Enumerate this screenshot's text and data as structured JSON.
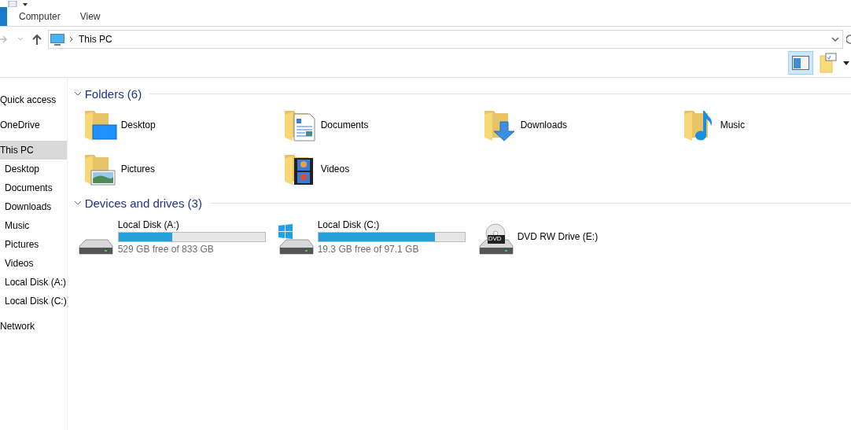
{
  "ribbon": {
    "tabs": [
      {
        "label": "Computer",
        "selected": false
      },
      {
        "label": "View",
        "selected": false
      }
    ]
  },
  "address": {
    "path": "This PC"
  },
  "toolbar": {
    "preview_pane": {
      "selected": true
    }
  },
  "sidebar": {
    "items": [
      {
        "label": "Quick access",
        "selected": false
      },
      {
        "label": "OneDrive",
        "selected": false
      },
      {
        "label": "This PC",
        "selected": true,
        "children": [
          {
            "label": "Desktop",
            "selected": false
          },
          {
            "label": "Documents",
            "selected": false
          },
          {
            "label": "Downloads",
            "selected": false
          },
          {
            "label": "Music",
            "selected": false
          },
          {
            "label": "Pictures",
            "selected": false
          },
          {
            "label": "Videos",
            "selected": false
          },
          {
            "label": "Local Disk (A:)",
            "selected": false
          },
          {
            "label": "Local Disk (C:)",
            "selected": false
          }
        ]
      },
      {
        "label": "Network",
        "selected": false
      }
    ]
  },
  "sections": [
    {
      "title": "Folders (6)",
      "expanded": true,
      "items": [
        {
          "kind": "desktop",
          "name": "Desktop"
        },
        {
          "kind": "documents",
          "name": "Documents"
        },
        {
          "kind": "downloads",
          "name": "Downloads"
        },
        {
          "kind": "music",
          "name": "Music"
        },
        {
          "kind": "pictures",
          "name": "Pictures"
        },
        {
          "kind": "videos",
          "name": "Videos"
        }
      ]
    },
    {
      "title": "Devices and drives (3)",
      "expanded": true,
      "items": [
        {
          "kind": "disk",
          "name": "Local Disk (A:)",
          "level": 0.365,
          "free": "529 GB free of 833 GB"
        },
        {
          "kind": "system_disk",
          "name": "Local Disk (C:)",
          "level": 0.8,
          "free": "19.3 GB free of 97.1 GB"
        },
        {
          "kind": "optical",
          "name": "DVD RW Drive (E:)",
          "badge": "DVD"
        }
      ]
    }
  ]
}
